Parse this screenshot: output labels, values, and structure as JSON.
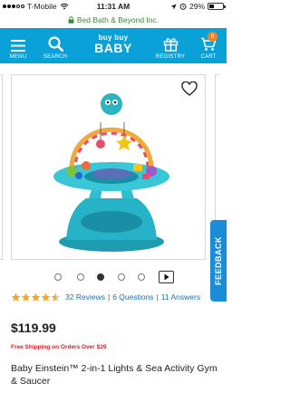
{
  "status_bar": {
    "carrier": "T-Mobile",
    "time": "11:31 AM",
    "battery": "29%",
    "battery_level": 0.29
  },
  "url_bar": {
    "domain": "Bed Bath & Beyond Inc."
  },
  "header": {
    "menu_label": "MENU",
    "search_label": "SEARCH",
    "logo_line1": "buy buy",
    "logo_line2": "BABY",
    "registry_label": "REGISTRY",
    "cart_label": "CART",
    "cart_count": "0",
    "background": "#0aa0d8"
  },
  "gallery": {
    "image_count": 5,
    "active_index": 2,
    "icons": [
      "heart-icon",
      "next-arrow-icon"
    ]
  },
  "feedback_tab": {
    "label": "FEEDBACK"
  },
  "rating": {
    "stars": 4.5,
    "reviews_count": "32",
    "reviews_label": "Reviews",
    "questions": "6 Questions",
    "answers": "11 Answers",
    "star_color": "#f5a623"
  },
  "price": "$119.99",
  "shipping": "Free Shipping on Orders Over $29",
  "product_title": "Baby Einstein™ 2-in-1 Lights & Sea Activity Gym & Saucer"
}
